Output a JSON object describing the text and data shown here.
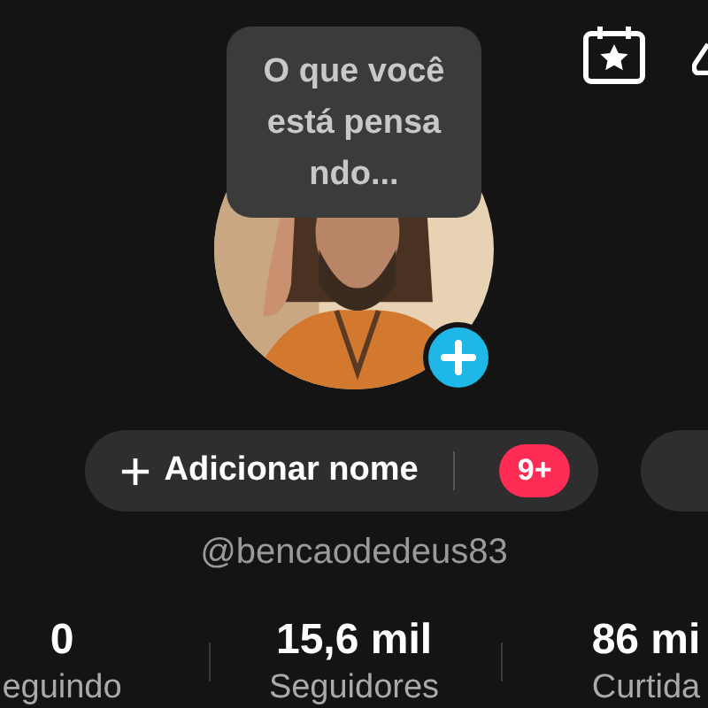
{
  "thought_bubble": {
    "lines": [
      "O que você",
      "está pensa",
      "ndo..."
    ]
  },
  "name_button": {
    "label": "Adicionar nome",
    "badge": "9+"
  },
  "handle": "@bencaodedeus83",
  "stats": [
    {
      "value": "0",
      "label": "eguindo"
    },
    {
      "value": "15,6 mil",
      "label": "Seguidores"
    },
    {
      "value": "86 mi",
      "label": "Curtida"
    }
  ]
}
